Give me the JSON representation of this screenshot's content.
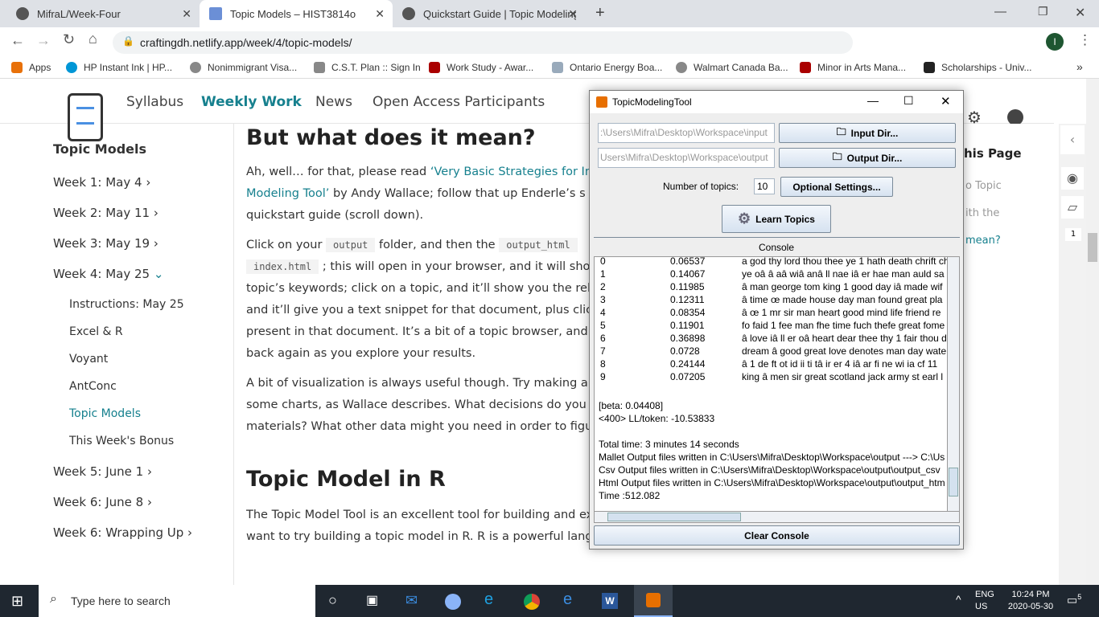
{
  "browser": {
    "tabs": [
      {
        "label": "MifraL/Week-Four",
        "icon": "github-icon"
      },
      {
        "label": "Topic Models – HIST3814o",
        "icon": "page-icon"
      },
      {
        "label": "Quickstart Guide | Topic Modeling",
        "icon": "globe-icon"
      }
    ],
    "url": "craftingdh.netlify.app/week/4/topic-models/",
    "bookmarks": [
      "Apps",
      "HP Instant Ink | HP...",
      "Nonimmigrant Visa...",
      "C.S.T. Plan :: Sign In",
      "Work Study - Awar...",
      "Ontario Energy Boa...",
      "Walmart Canada Ba...",
      "Minor in Arts Mana...",
      "Scholarships - Univ..."
    ]
  },
  "site": {
    "nav": [
      "Syllabus",
      "Weekly Work",
      "News",
      "Open Access Participants"
    ],
    "sidebar_title": "Topic Models",
    "weeks": [
      "Week 1: May 4",
      "Week 2: May 11",
      "Week 3: May 19",
      "Week 4: May 25"
    ],
    "week4_items": [
      "Instructions: May 25",
      "Excel & R",
      "Voyant",
      "AntConc",
      "Topic Models",
      "This Week's Bonus"
    ],
    "weeks_after": [
      "Week 5: June 1",
      "Week 6: June 8",
      "Week 6: Wrapping Up"
    ],
    "toc_title": "his Page",
    "toc_items": [
      "o Topic",
      "ith the",
      "mean?"
    ],
    "annotation_count": "1",
    "heading1": "But what does it mean?",
    "p1a": "Ah, well… for that, please read ",
    "p1link": "‘Very Basic Strategies for In",
    "p1link2": "Modeling Tool’",
    "p1b": " by Andy Wallace; follow that up Enderle’s s",
    "p1c": "quickstart guide (scroll down).",
    "p2a": "Click on your ",
    "code1": "output",
    "p2b": " folder, and then the ",
    "code2": "output_html",
    "code3": "index.html",
    "p2c": " ; this will open in your browser, and it will sho",
    "p2lines": [
      "topic’s keywords; click on a topic, and it’ll show you the rel",
      "and it’ll give you a text snippet for that document, plus clic",
      "present in that document. It’s a bit of a topic browser, and",
      "back again as you explore your results."
    ],
    "p3lines": [
      "A bit of visualization is always useful though. Try making a",
      "some charts, as Wallace describes. What decisions do you",
      "materials? What other data might you need in order to figu"
    ],
    "heading2": "Topic Model in R",
    "p4lines": [
      "The Topic Model Tool is an excellent tool for building and exploring topic models. But you might",
      "want to try building a topic model in R. R is a powerful language for statistical exploring, visualizing,"
    ]
  },
  "tool": {
    "title": "TopicModelingTool",
    "input_path": ":\\Users\\Mifra\\Desktop\\Workspace\\input",
    "output_path": "Users\\Mifra\\Desktop\\Workspace\\output",
    "input_btn": "Input Dir...",
    "output_btn": "Output Dir...",
    "num_topics_label": "Number of topics:",
    "num_topics": "10",
    "optional_btn": "Optional Settings...",
    "learn_btn": "Learn Topics",
    "console_label": "Console",
    "topics": [
      [
        "0",
        "0.06537",
        "a god thy lord thou thee ye 1 hath death chrift ch"
      ],
      [
        "1",
        "0.14067",
        "ye oâ â aâ wiâ anâ ll nae iâ er hae man auld sa"
      ],
      [
        "2",
        "0.11985",
        "â man george tom king 1 good day iâ made wif"
      ],
      [
        "3",
        "0.12311",
        "â time œ made house day man found great pla"
      ],
      [
        "4",
        "0.08354",
        "â œ 1 mr sir man heart good mind life friend re"
      ],
      [
        "5",
        "0.11901",
        "fo faid 1 fee man fhe time fuch thefe great fome"
      ],
      [
        "6",
        "0.36898",
        "â love iâ ll er oâ heart dear thee thy 1 fair thou d"
      ],
      [
        "7",
        "0.0728",
        "dream â good great love denotes man day wate"
      ],
      [
        "8",
        "0.24144",
        "â 1 de ft ot id ii ti tâ ir er 4 iâ ar fi ne wi ia cf 11"
      ],
      [
        "9",
        "0.07205",
        "king â men sir great scotland jack army st earl l"
      ]
    ],
    "log": [
      "[beta: 0.04408]",
      "<400> LL/token: -10.53833",
      "",
      "Total time: 3 minutes 14 seconds",
      "Mallet Output files written in C:\\Users\\Mifra\\Desktop\\Workspace\\output ---> C:\\Us",
      "Csv Output files written in C:\\Users\\Mifra\\Desktop\\Workspace\\output\\output_csv",
      "Html Output files written in C:\\Users\\Mifra\\Desktop\\Workspace\\output\\output_htm",
      "Time :512.082"
    ],
    "clear_btn": "Clear Console"
  },
  "taskbar": {
    "search_placeholder": "Type here to search",
    "lang": "ENG",
    "region": "US",
    "time": "10:24 PM",
    "date": "2020-05-30",
    "notifications": "5"
  }
}
